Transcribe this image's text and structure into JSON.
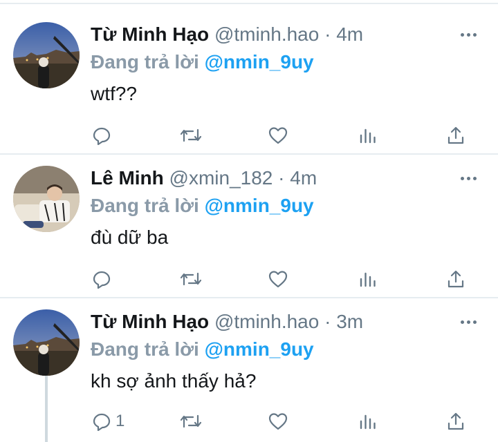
{
  "reply_prefix": "Đang trả lời",
  "tweets": [
    {
      "name": "Từ Minh Hạo",
      "handle": "@tminh.hao",
      "separator": "·",
      "time": "4m",
      "reply_to": "@nmin_9uy",
      "text": "wtf??",
      "reply_count": ""
    },
    {
      "name": "Lê Minh",
      "handle": "@xmin_182",
      "separator": "·",
      "time": "4m",
      "reply_to": "@nmin_9uy",
      "text": "đù dữ ba",
      "reply_count": ""
    },
    {
      "name": "Từ Minh Hạo",
      "handle": "@tminh.hao",
      "separator": "·",
      "time": "3m",
      "reply_to": "@nmin_9uy",
      "text": "kh sợ ảnh thấy hả?",
      "reply_count": "1"
    }
  ],
  "icons": {
    "reply": "reply-icon",
    "retweet": "retweet-icon",
    "like": "heart-icon",
    "analytics": "analytics-icon",
    "share": "share-icon",
    "more": "more-icon"
  },
  "colors": {
    "accent": "#1da1f2",
    "secondary_text": "#657786",
    "divider": "#e6ecf0"
  }
}
